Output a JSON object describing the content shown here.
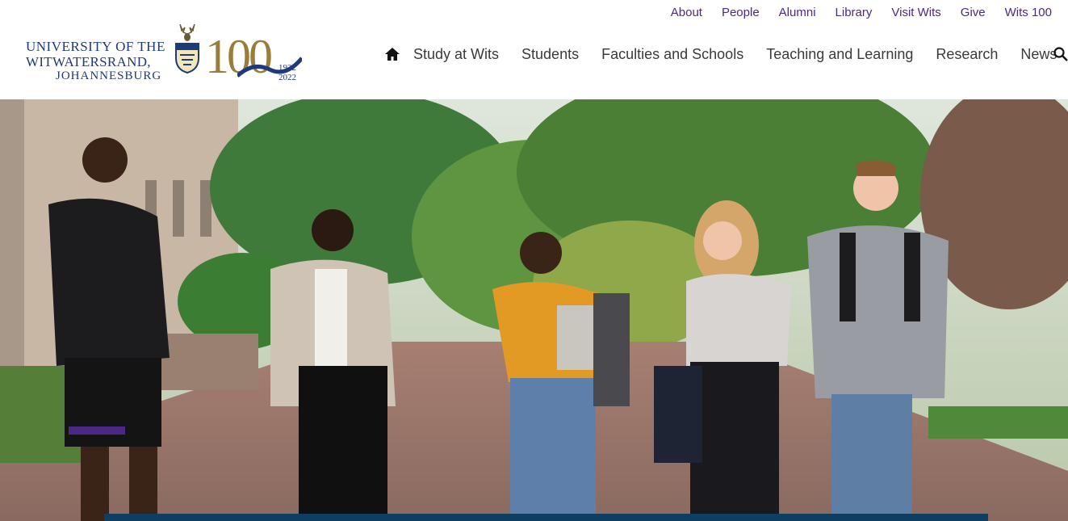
{
  "utility_nav": [
    {
      "label": "About"
    },
    {
      "label": "People"
    },
    {
      "label": "Alumni"
    },
    {
      "label": "Library"
    },
    {
      "label": "Visit Wits"
    },
    {
      "label": "Give"
    },
    {
      "label": "Wits 100"
    }
  ],
  "logo": {
    "line1": "UNIVERSITY OF THE",
    "line2": "WITWATERSRAND,",
    "line3": "JOHANNESBURG",
    "centenary": "100",
    "year_start": "1922",
    "year_end": "2022"
  },
  "main_nav": [
    {
      "label": "Study at Wits"
    },
    {
      "label": "Students"
    },
    {
      "label": "Faculties and Schools"
    },
    {
      "label": "Teaching and Learning"
    },
    {
      "label": "Research"
    },
    {
      "label": "News"
    }
  ],
  "icons": {
    "home": "home-icon",
    "search": "search-icon"
  },
  "colors": {
    "utility_link": "#4b2886",
    "logo_blue": "#1f3a7a",
    "logo_gold": "#9a7d3a",
    "hero_bar": "#0e3f63"
  }
}
